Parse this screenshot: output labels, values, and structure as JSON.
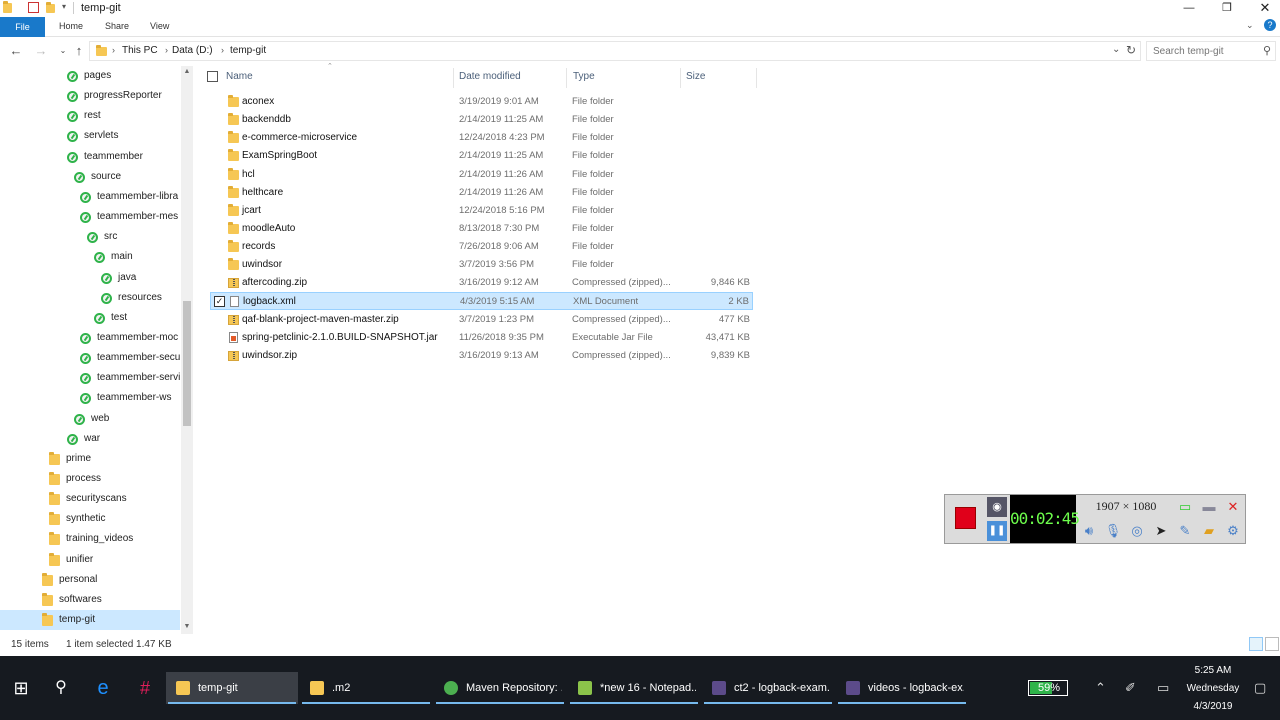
{
  "window": {
    "title": "temp-git"
  },
  "ribbon": {
    "file": "File",
    "home": "Home",
    "share": "Share",
    "view": "View"
  },
  "address": {
    "crumbs": [
      "This PC",
      "Data (D:)",
      "temp-git"
    ],
    "search_placeholder": "Search temp-git"
  },
  "nav_tree": [
    {
      "label": "pages",
      "icon": "git",
      "indent": 67
    },
    {
      "label": "progressReporter",
      "icon": "git",
      "indent": 67
    },
    {
      "label": "rest",
      "icon": "git",
      "indent": 67
    },
    {
      "label": "servlets",
      "icon": "git",
      "indent": 67
    },
    {
      "label": "teammember",
      "icon": "git",
      "indent": 67
    },
    {
      "label": "source",
      "icon": "git",
      "indent": 74
    },
    {
      "label": "teammember-libra",
      "icon": "git",
      "indent": 80
    },
    {
      "label": "teammember-mes",
      "icon": "git",
      "indent": 80
    },
    {
      "label": "src",
      "icon": "git",
      "indent": 87
    },
    {
      "label": "main",
      "icon": "git",
      "indent": 94
    },
    {
      "label": "java",
      "icon": "git",
      "indent": 101
    },
    {
      "label": "resources",
      "icon": "git",
      "indent": 101
    },
    {
      "label": "test",
      "icon": "git",
      "indent": 94
    },
    {
      "label": "teammember-moc",
      "icon": "git",
      "indent": 80
    },
    {
      "label": "teammember-secu",
      "icon": "git",
      "indent": 80
    },
    {
      "label": "teammember-servi",
      "icon": "git",
      "indent": 80
    },
    {
      "label": "teammember-ws",
      "icon": "git",
      "indent": 80
    },
    {
      "label": "web",
      "icon": "git",
      "indent": 74
    },
    {
      "label": "war",
      "icon": "git",
      "indent": 67
    },
    {
      "label": "prime",
      "icon": "folder",
      "indent": 49
    },
    {
      "label": "process",
      "icon": "folder",
      "indent": 49
    },
    {
      "label": "securityscans",
      "icon": "folder",
      "indent": 49
    },
    {
      "label": "synthetic",
      "icon": "folder",
      "indent": 49
    },
    {
      "label": "training_videos",
      "icon": "folder",
      "indent": 49
    },
    {
      "label": "unifier",
      "icon": "folder",
      "indent": 49
    },
    {
      "label": "personal",
      "icon": "folder",
      "indent": 42
    },
    {
      "label": "softwares",
      "icon": "folder",
      "indent": 42
    },
    {
      "label": "temp-git",
      "icon": "folder",
      "indent": 42,
      "selected": true
    }
  ],
  "columns": {
    "name": "Name",
    "date": "Date modified",
    "type": "Type",
    "size": "Size"
  },
  "files": [
    {
      "name": "aconex",
      "date": "3/19/2019 9:01 AM",
      "type": "File folder",
      "size": "",
      "icon": "folder"
    },
    {
      "name": "backenddb",
      "date": "2/14/2019 11:25 AM",
      "type": "File folder",
      "size": "",
      "icon": "folder"
    },
    {
      "name": "e-commerce-microservice",
      "date": "12/24/2018 4:23 PM",
      "type": "File folder",
      "size": "",
      "icon": "folder"
    },
    {
      "name": "ExamSpringBoot",
      "date": "2/14/2019 11:25 AM",
      "type": "File folder",
      "size": "",
      "icon": "folder"
    },
    {
      "name": "hcl",
      "date": "2/14/2019 11:26 AM",
      "type": "File folder",
      "size": "",
      "icon": "folder"
    },
    {
      "name": "helthcare",
      "date": "2/14/2019 11:26 AM",
      "type": "File folder",
      "size": "",
      "icon": "folder"
    },
    {
      "name": "jcart",
      "date": "12/24/2018 5:16 PM",
      "type": "File folder",
      "size": "",
      "icon": "folder"
    },
    {
      "name": "moodleAuto",
      "date": "8/13/2018 7:30 PM",
      "type": "File folder",
      "size": "",
      "icon": "folder"
    },
    {
      "name": "records",
      "date": "7/26/2018 9:06 AM",
      "type": "File folder",
      "size": "",
      "icon": "folder"
    },
    {
      "name": "uwindsor",
      "date": "3/7/2019 3:56 PM",
      "type": "File folder",
      "size": "",
      "icon": "folder"
    },
    {
      "name": "aftercoding.zip",
      "date": "3/16/2019 9:12 AM",
      "type": "Compressed (zipped)...",
      "size": "9,846 KB",
      "icon": "zip"
    },
    {
      "name": "logback.xml",
      "date": "4/3/2019 5:15 AM",
      "type": "XML Document",
      "size": "2 KB",
      "icon": "doc",
      "selected": true
    },
    {
      "name": "qaf-blank-project-maven-master.zip",
      "date": "3/7/2019 1:23 PM",
      "type": "Compressed (zipped)...",
      "size": "477 KB",
      "icon": "zip"
    },
    {
      "name": "spring-petclinic-2.1.0.BUILD-SNAPSHOT.jar",
      "date": "11/26/2018 9:35 PM",
      "type": "Executable Jar File",
      "size": "43,471 KB",
      "icon": "jar"
    },
    {
      "name": "uwindsor.zip",
      "date": "3/16/2019 9:13 AM",
      "type": "Compressed (zipped)...",
      "size": "9,839 KB",
      "icon": "zip"
    }
  ],
  "status": {
    "count": "15 items",
    "selection": "1 item selected  1.47 KB"
  },
  "recorder": {
    "time": "00:02:45",
    "resolution": "1907 × 1080"
  },
  "taskbar": {
    "tasks": [
      {
        "label": "temp-git",
        "icon": "folder",
        "active": true
      },
      {
        "label": ".m2",
        "icon": "folder",
        "active": false
      },
      {
        "label": "Maven Repository: ...",
        "icon": "chrome",
        "active": false
      },
      {
        "label": "*new 16 - Notepad...",
        "icon": "notepad",
        "active": false
      },
      {
        "label": "ct2 - logback-exam...",
        "icon": "eclipse",
        "active": false
      },
      {
        "label": "videos - logback-ex...",
        "icon": "eclipse",
        "active": false
      }
    ],
    "battery": "59%",
    "battery_level": 0.59,
    "time": "5:25 AM",
    "day": "Wednesday",
    "date": "4/3/2019"
  },
  "colors": {
    "accent": "#1979ca",
    "selection": "#cce8ff",
    "git_green": "#2fb34a",
    "record_red": "#e0001a"
  }
}
